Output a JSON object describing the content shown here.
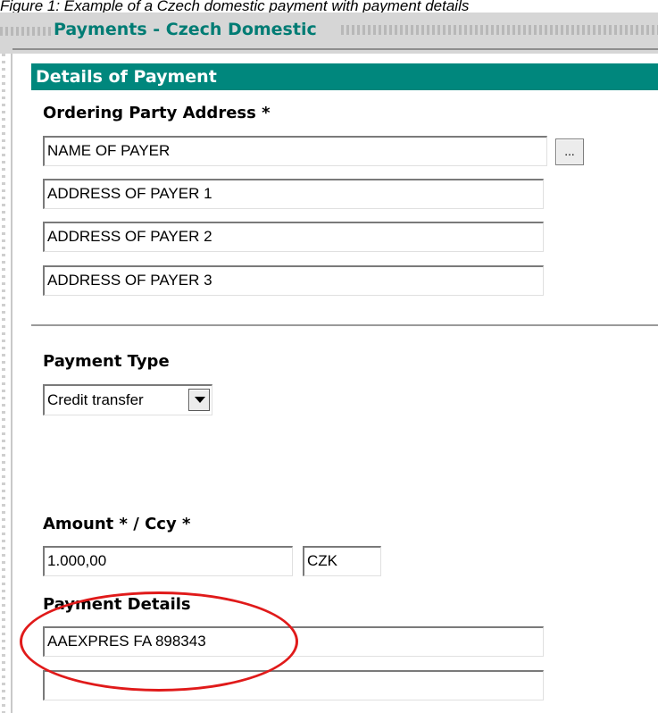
{
  "caption": "Figure 1: Example of a Czech domestic payment with payment details",
  "page_title": "Payments - Czech Domestic",
  "section": {
    "title": "Details of Payment"
  },
  "ordering_party": {
    "label": "Ordering Party Address  *",
    "name": "NAME OF PAYER",
    "address_1": "ADDRESS OF PAYER 1",
    "address_2": "ADDRESS OF PAYER 2",
    "address_3": "ADDRESS OF PAYER 3",
    "lookup_button": "..."
  },
  "payment_type": {
    "label": "Payment Type",
    "selected": "Credit transfer"
  },
  "amount": {
    "label": "Amount * / Ccy *",
    "value": "1.000,00",
    "currency": "CZK"
  },
  "payment_details": {
    "label": "Payment Details",
    "line_1": "AAEXPRES FA 898343",
    "line_2": ""
  },
  "colors": {
    "header_bg": "#00877d",
    "title_color": "#007c74",
    "highlight": "#e01a1a"
  },
  "icons": {
    "dropdown": "chevron-down-icon"
  }
}
